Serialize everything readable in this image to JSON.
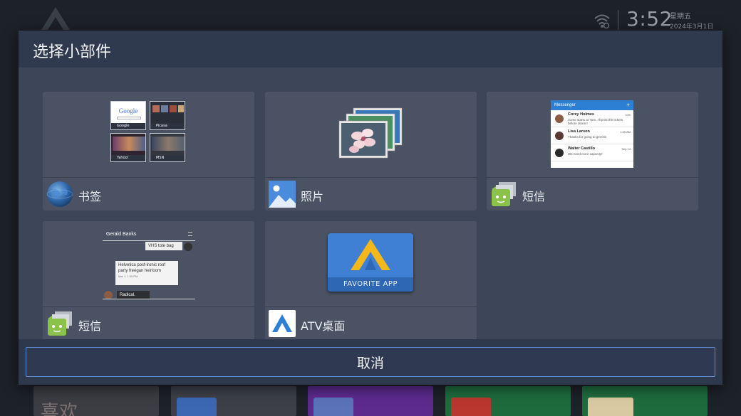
{
  "status_bar": {
    "time": "3:52",
    "weekday": "星期五",
    "date": "2024年3月1日"
  },
  "background_apps": {
    "first_tile_text": "喜欢"
  },
  "dialog": {
    "title": "选择小部件",
    "cancel_label": "取消",
    "widgets": [
      {
        "label": "书签",
        "icon": "globe-icon",
        "preview": {
          "tiles": [
            "Google",
            "Picasa",
            "Yahoo!",
            "MSN"
          ],
          "logo_text": "Google"
        }
      },
      {
        "label": "照片",
        "icon": "photos-icon"
      },
      {
        "label": "短信",
        "icon": "messaging-icon",
        "preview": {
          "header": "Messenger",
          "add_glyph": "+",
          "conversations": [
            {
              "name": "Corey Holmes",
              "text": "Some starts at 7pm. I'll print the tickets before dinner!",
              "time": "10m"
            },
            {
              "name": "Lisa Larson",
              "text": "Thanks for going to get this",
              "time": "1:05 AM"
            },
            {
              "name": "Walter Castillo",
              "text": "We need more capacity!",
              "time": "Sep 14"
            }
          ]
        }
      },
      {
        "label": "短信",
        "icon": "messaging-icon",
        "preview": {
          "contact": "Gerald Banks",
          "reply_bubble": "VHS tote bag",
          "incoming_text": "Helvetica post-ironic roof party freegan heirloom",
          "incoming_time": "Mar 1, 1:35 PM",
          "outgoing_text": "Radical."
        }
      },
      {
        "label": "ATV桌面",
        "icon": "atv-launcher-icon",
        "preview": {
          "caption": "FAVORITE APP"
        }
      }
    ]
  },
  "colors": {
    "dialog_bg": "#3d4659",
    "header_bg": "#303a4f",
    "card_bg": "#4a5264",
    "button_border": "#5e8fd6",
    "atv_blue": "#3f7fd4",
    "atv_yellow": "#f4b81d",
    "messaging_green": "#8bc34a"
  }
}
